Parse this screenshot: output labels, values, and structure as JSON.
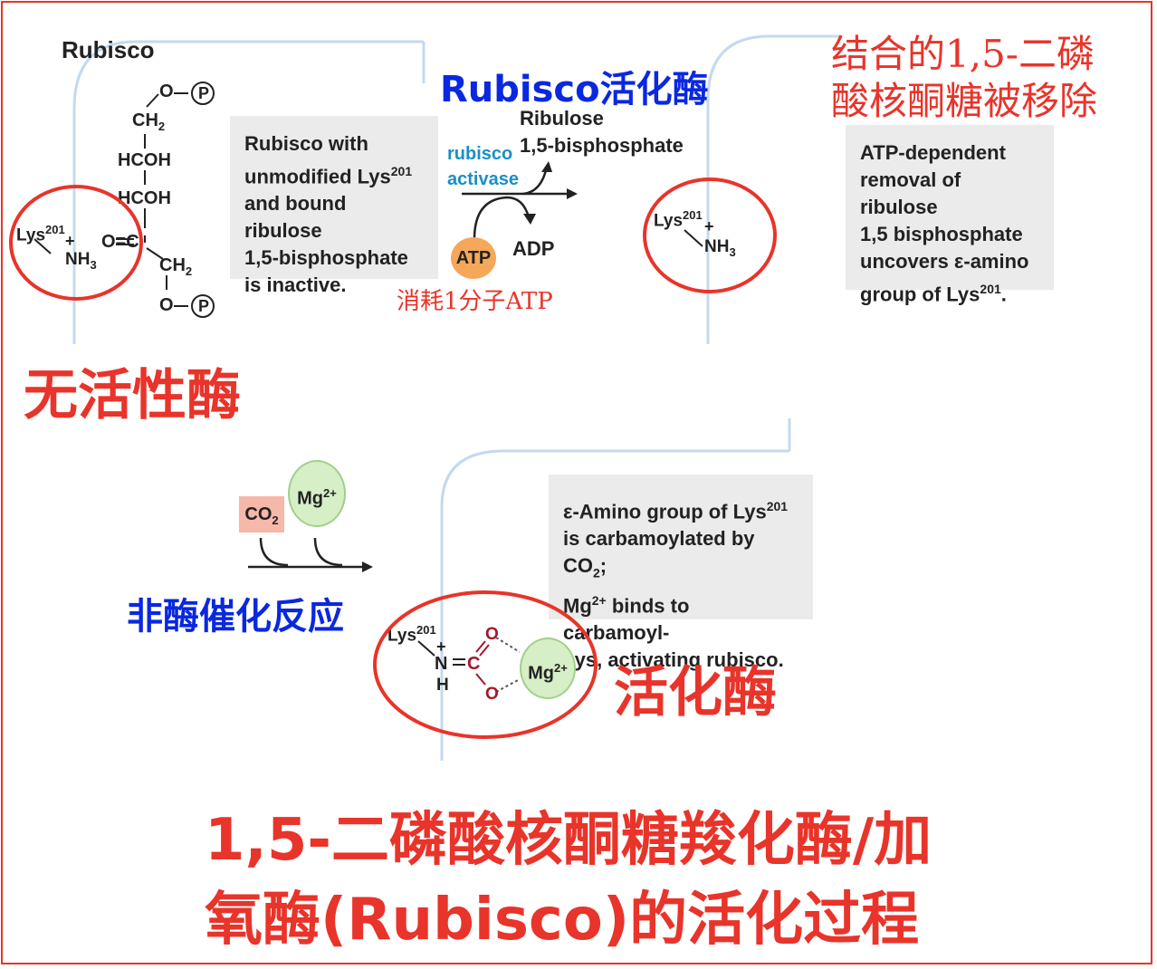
{
  "header": {
    "rubisco": "Rubisco"
  },
  "label_activase_cn": "Rubisco活化酶",
  "label_removed_cn": {
    "line1": "结合的1,5-二磷",
    "line2": "酸核酮糖被移除"
  },
  "note1": {
    "l1": "Rubisco with",
    "l2": "unmodified Lys",
    "l2sup": "201",
    "l3": "and bound ribulose",
    "l4": "1,5-bisphosphate",
    "l5": "is inactive."
  },
  "note2": {
    "l1": "ATP-dependent",
    "l2": "removal of ribulose",
    "l3": "1,5 bisphosphate",
    "l4": "uncovers ε-amino",
    "l5": "group of Lys",
    "l5sup": "201",
    "l5end": "."
  },
  "note3": {
    "l1a": "ε-Amino group of Lys",
    "l1sup": "201",
    "l2": "is carbamoylated by CO",
    "l2sub": "2",
    "l2end": ";",
    "l3a": "Mg",
    "l3sup": "2+",
    "l3b": " binds to carbamoyl-",
    "l4": "Lys, activating rubisco."
  },
  "reaction1": {
    "enzyme_l1": "rubisco",
    "enzyme_l2": "activase",
    "product_l1": "Ribulose",
    "product_l2": "1,5-bisphosphate",
    "atp": "ATP",
    "adp": "ADP",
    "atp_cost_cn": "消耗1分子ATP"
  },
  "reaction2": {
    "co2": "CO",
    "co2sub": "2",
    "mg": "Mg",
    "mgsup": "2+"
  },
  "label_inactive_cn": "无活性酶",
  "label_nonenzymatic_cn": "非酶催化反应",
  "label_active_cn": "活化酶",
  "title_cn": {
    "line1": "1,5-二磷酸核酮糖羧化酶/加",
    "line2": "氧酶(Rubisco)的活化过程"
  },
  "chem": {
    "phosphate": "P",
    "ch2": "CH",
    "sub2": "2",
    "hcoh": "HCOH",
    "o": "O",
    "co": "O=C",
    "lys": "Lys",
    "lyssup": "201",
    "plus": "+",
    "nh3": "NH",
    "sub3": "3",
    "n": "N",
    "h": "H",
    "c": "C",
    "mg": "Mg",
    "mgsup": "2+"
  },
  "colors": {
    "accent_red": "#e8342a",
    "label_blue": "#0a28e0",
    "activase_blue": "#1a8fc7",
    "atp_orange": "#f5a85a",
    "mg_green": "#d6efc6",
    "co2_pink": "#f6b8a8",
    "panel_line": "#c5d9ee"
  }
}
